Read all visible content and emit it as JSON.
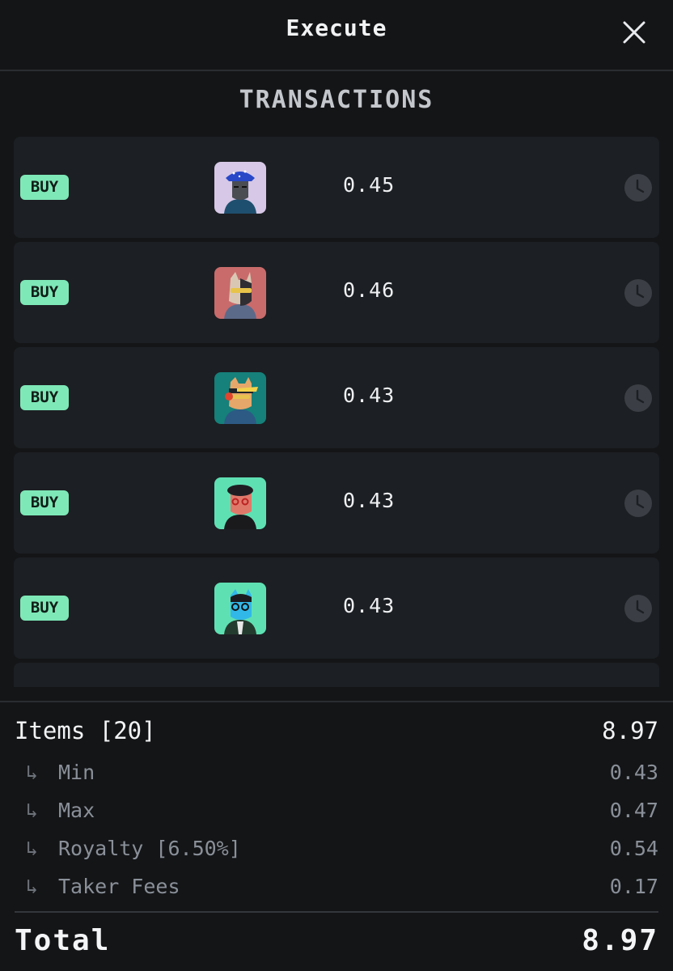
{
  "header": {
    "title": "Execute"
  },
  "section": {
    "title": "TRANSACTIONS"
  },
  "transactions": [
    {
      "type": "BUY",
      "price": "0.45"
    },
    {
      "type": "BUY",
      "price": "0.46"
    },
    {
      "type": "BUY",
      "price": "0.43"
    },
    {
      "type": "BUY",
      "price": "0.43"
    },
    {
      "type": "BUY",
      "price": "0.43"
    }
  ],
  "summary": {
    "items_label": "Items [20]",
    "items_value": "8.97",
    "sub_arrow": "↳",
    "min_label": "Min",
    "min_value": "0.43",
    "max_label": "Max",
    "max_value": "0.47",
    "royalty_label": "Royalty [6.50%]",
    "royalty_value": "0.54",
    "taker_label": "Taker Fees",
    "taker_value": "0.17",
    "total_label": "Total",
    "total_value": "8.97"
  },
  "colors": {
    "background": "#141517",
    "row_bg": "#1c1f23",
    "buy_badge": "#7ee8b7",
    "clock_icon": "#3b3f45"
  },
  "icons": {
    "close": "close-icon",
    "pending": "clock-icon"
  }
}
